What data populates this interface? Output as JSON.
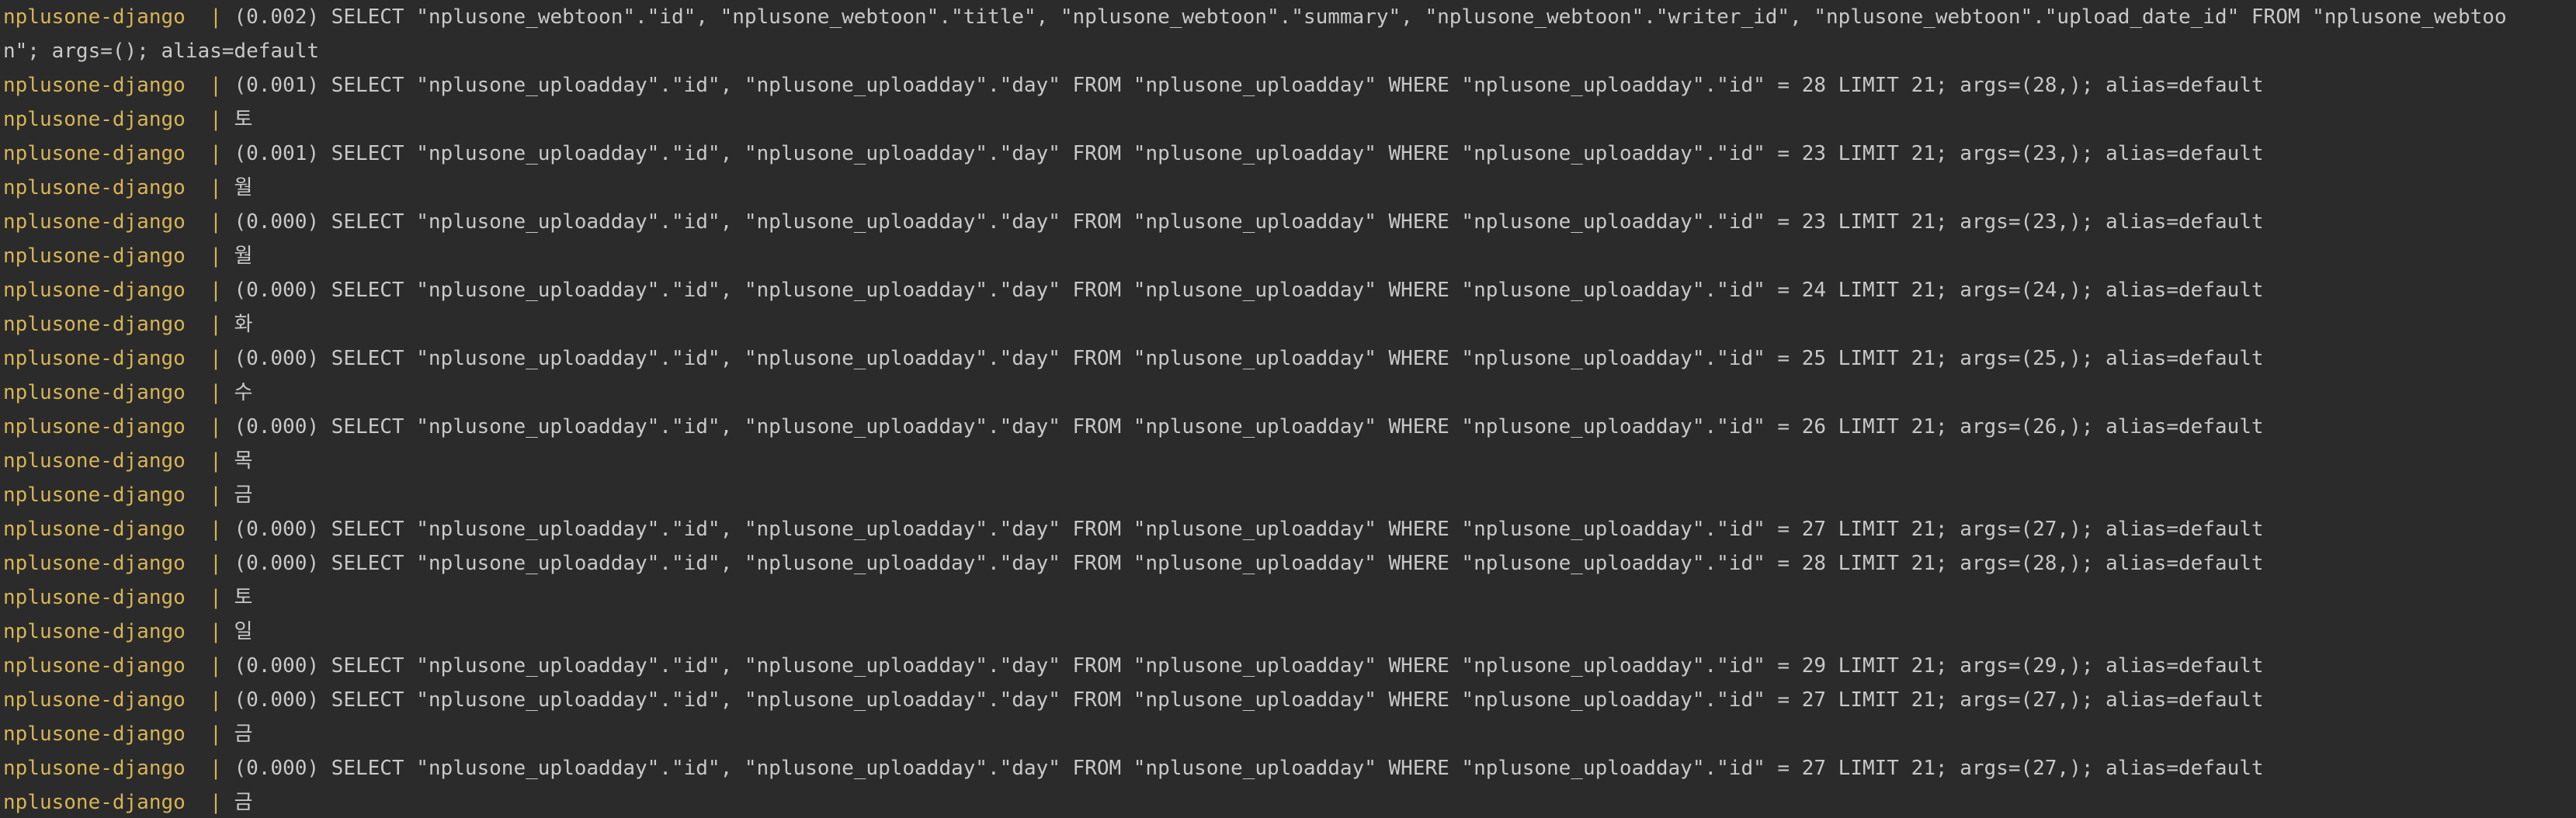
{
  "terminal": {
    "container_name": "nplusone-django",
    "separator": "  | ",
    "lines": [
      {
        "prefix": "nplusone-django",
        "text": "(0.002) SELECT \"nplusone_webtoon\".\"id\", \"nplusone_webtoon\".\"title\", \"nplusone_webtoon\".\"summary\", \"nplusone_webtoon\".\"writer_id\", \"nplusone_webtoon\".\"upload_date_id\" FROM \"nplusone_webtoo"
      },
      {
        "prefix": "",
        "text": "n\"; args=(); alias=default"
      },
      {
        "prefix": "nplusone-django",
        "text": "(0.001) SELECT \"nplusone_uploadday\".\"id\", \"nplusone_uploadday\".\"day\" FROM \"nplusone_uploadday\" WHERE \"nplusone_uploadday\".\"id\" = 28 LIMIT 21; args=(28,); alias=default"
      },
      {
        "prefix": "nplusone-django",
        "text": "토"
      },
      {
        "prefix": "nplusone-django",
        "text": "(0.001) SELECT \"nplusone_uploadday\".\"id\", \"nplusone_uploadday\".\"day\" FROM \"nplusone_uploadday\" WHERE \"nplusone_uploadday\".\"id\" = 23 LIMIT 21; args=(23,); alias=default"
      },
      {
        "prefix": "nplusone-django",
        "text": "월"
      },
      {
        "prefix": "nplusone-django",
        "text": "(0.000) SELECT \"nplusone_uploadday\".\"id\", \"nplusone_uploadday\".\"day\" FROM \"nplusone_uploadday\" WHERE \"nplusone_uploadday\".\"id\" = 23 LIMIT 21; args=(23,); alias=default"
      },
      {
        "prefix": "nplusone-django",
        "text": "월"
      },
      {
        "prefix": "nplusone-django",
        "text": "(0.000) SELECT \"nplusone_uploadday\".\"id\", \"nplusone_uploadday\".\"day\" FROM \"nplusone_uploadday\" WHERE \"nplusone_uploadday\".\"id\" = 24 LIMIT 21; args=(24,); alias=default"
      },
      {
        "prefix": "nplusone-django",
        "text": "화"
      },
      {
        "prefix": "nplusone-django",
        "text": "(0.000) SELECT \"nplusone_uploadday\".\"id\", \"nplusone_uploadday\".\"day\" FROM \"nplusone_uploadday\" WHERE \"nplusone_uploadday\".\"id\" = 25 LIMIT 21; args=(25,); alias=default"
      },
      {
        "prefix": "nplusone-django",
        "text": "수"
      },
      {
        "prefix": "nplusone-django",
        "text": "(0.000) SELECT \"nplusone_uploadday\".\"id\", \"nplusone_uploadday\".\"day\" FROM \"nplusone_uploadday\" WHERE \"nplusone_uploadday\".\"id\" = 26 LIMIT 21; args=(26,); alias=default"
      },
      {
        "prefix": "nplusone-django",
        "text": "목"
      },
      {
        "prefix": "nplusone-django",
        "text": "금"
      },
      {
        "prefix": "nplusone-django",
        "text": "(0.000) SELECT \"nplusone_uploadday\".\"id\", \"nplusone_uploadday\".\"day\" FROM \"nplusone_uploadday\" WHERE \"nplusone_uploadday\".\"id\" = 27 LIMIT 21; args=(27,); alias=default"
      },
      {
        "prefix": "nplusone-django",
        "text": "(0.000) SELECT \"nplusone_uploadday\".\"id\", \"nplusone_uploadday\".\"day\" FROM \"nplusone_uploadday\" WHERE \"nplusone_uploadday\".\"id\" = 28 LIMIT 21; args=(28,); alias=default"
      },
      {
        "prefix": "nplusone-django",
        "text": "토"
      },
      {
        "prefix": "nplusone-django",
        "text": "일"
      },
      {
        "prefix": "nplusone-django",
        "text": "(0.000) SELECT \"nplusone_uploadday\".\"id\", \"nplusone_uploadday\".\"day\" FROM \"nplusone_uploadday\" WHERE \"nplusone_uploadday\".\"id\" = 29 LIMIT 21; args=(29,); alias=default"
      },
      {
        "prefix": "nplusone-django",
        "text": "(0.000) SELECT \"nplusone_uploadday\".\"id\", \"nplusone_uploadday\".\"day\" FROM \"nplusone_uploadday\" WHERE \"nplusone_uploadday\".\"id\" = 27 LIMIT 21; args=(27,); alias=default"
      },
      {
        "prefix": "nplusone-django",
        "text": "금"
      },
      {
        "prefix": "nplusone-django",
        "text": "(0.000) SELECT \"nplusone_uploadday\".\"id\", \"nplusone_uploadday\".\"day\" FROM \"nplusone_uploadday\" WHERE \"nplusone_uploadday\".\"id\" = 27 LIMIT 21; args=(27,); alias=default"
      },
      {
        "prefix": "nplusone-django",
        "text": "금"
      }
    ]
  },
  "colors": {
    "background": "#2b2b2b",
    "prefix": "#d6b456",
    "text": "#c8c8c8"
  }
}
